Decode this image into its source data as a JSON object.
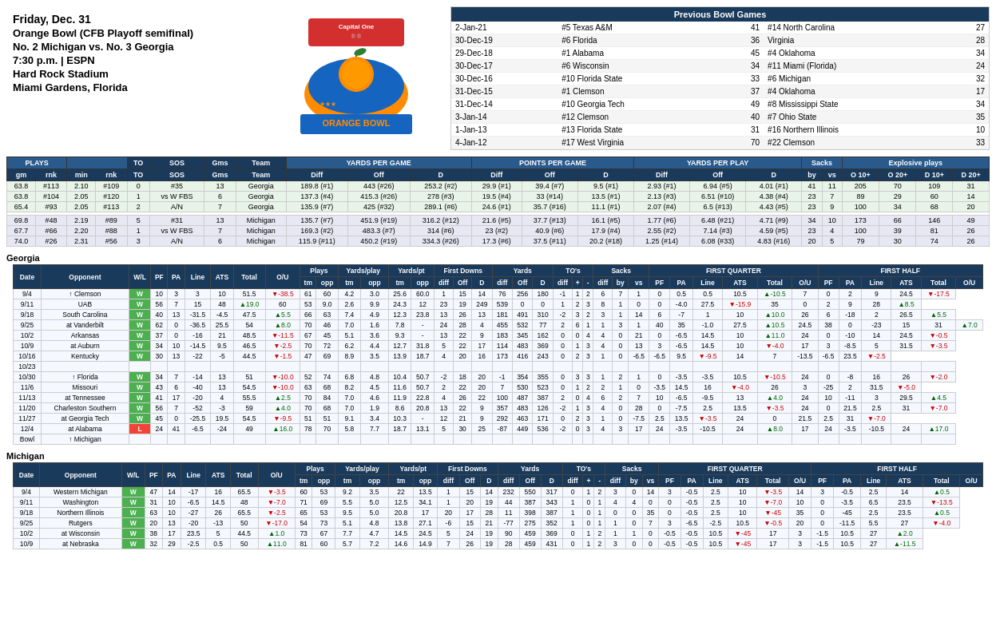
{
  "header": {
    "day": "Friday, Dec. 31",
    "bowl": "Orange Bowl (CFB Playoff semifinal)",
    "matchup": "No. 2 Michigan vs. No. 3 Georgia",
    "time": "7:30 p.m. | ESPN",
    "venue": "Hard Rock Stadium",
    "location": "Miami Gardens, Florida"
  },
  "previousBowlGames": {
    "title": "Previous Bowl Games",
    "columns": [
      "Date",
      "Team1",
      "Score1",
      "Team2",
      "Score2"
    ],
    "rows": [
      [
        "2-Jan-21",
        "#5 Texas A&M",
        "41",
        "#14 North Carolina",
        "27"
      ],
      [
        "30-Dec-19",
        "#6 Florida",
        "36",
        "Virginia",
        "28"
      ],
      [
        "29-Dec-18",
        "#1 Alabama",
        "45",
        "#4 Oklahoma",
        "34"
      ],
      [
        "30-Dec-17",
        "#6 Wisconsin",
        "34",
        "#11 Miami (Florida)",
        "24"
      ],
      [
        "30-Dec-16",
        "#10 Florida State",
        "33",
        "#6 Michigan",
        "32"
      ],
      [
        "31-Dec-15",
        "#1 Clemson",
        "37",
        "#4 Oklahoma",
        "17"
      ],
      [
        "31-Dec-14",
        "#10 Georgia Tech",
        "49",
        "#8 Mississippi State",
        "34"
      ],
      [
        "3-Jan-14",
        "#12 Clemson",
        "40",
        "#7 Ohio State",
        "35"
      ],
      [
        "1-Jan-13",
        "#13 Florida State",
        "31",
        "#16 Northern Illinois",
        "10"
      ],
      [
        "4-Jan-12",
        "#17 West Virginia",
        "70",
        "#22 Clemson",
        "33"
      ]
    ]
  },
  "statsSection": {
    "groupHeaders": {
      "plays": "PLAYS",
      "yardsPerGame": "YARDS PER GAME",
      "pointsPerGame": "POINTS PER GAME",
      "yardsPerPlay": "YARDS PER PLAY",
      "sacks": "Sacks",
      "explosivePlays": "Explosive plays"
    },
    "columnHeaders": [
      "gm",
      "rnk",
      "min",
      "rnk",
      "TO",
      "SOS",
      "Gms",
      "Team",
      "Diff",
      "Off",
      "D",
      "Diff",
      "Off",
      "D",
      "Diff",
      "Off",
      "D",
      "by",
      "vs",
      "O 10+",
      "O 20+",
      "D 10+",
      "D 20+"
    ],
    "georgiaRows": [
      [
        "63.8",
        "#113",
        "2.10",
        "#109",
        "0",
        "#35",
        "13",
        "Georgia",
        "189.8 (#1)",
        "443 (#26)",
        "253.2 (#2)",
        "29.9 (#1)",
        "39.4 (#7)",
        "9.5 (#1)",
        "2.93 (#1)",
        "6.94 (#5)",
        "4.01 (#1)",
        "41",
        "11",
        "205",
        "70",
        "109",
        "31"
      ],
      [
        "63.8",
        "#104",
        "2.05",
        "#120",
        "1",
        "vs W FBS",
        "6",
        "Georgia",
        "137.3 (#4)",
        "415.3 (#26)",
        "278 (#3)",
        "19.5 (#4)",
        "33 (#14)",
        "13.5 (#1)",
        "2.13 (#3)",
        "6.51 (#10)",
        "4.38 (#4)",
        "23",
        "7",
        "89",
        "29",
        "60",
        "14"
      ],
      [
        "65.4",
        "#93",
        "2.05",
        "#113",
        "2",
        "A/N",
        "7",
        "Georgia",
        "135.9 (#7)",
        "425 (#32)",
        "289.1 (#6)",
        "24.6 (#1)",
        "35.7 (#16)",
        "11.1 (#1)",
        "2.07 (#4)",
        "6.5 (#13)",
        "4.43 (#5)",
        "23",
        "9",
        "100",
        "34",
        "68",
        "20"
      ]
    ],
    "michiganRows": [
      [
        "69.8",
        "#48",
        "2.19",
        "#89",
        "5",
        "#31",
        "13",
        "Michigan",
        "135.7 (#7)",
        "451.9 (#19)",
        "316.2 (#12)",
        "21.6 (#5)",
        "37.7 (#13)",
        "16.1 (#5)",
        "1.77 (#6)",
        "6.48 (#21)",
        "4.71 (#9)",
        "34",
        "10",
        "173",
        "66",
        "146",
        "49"
      ],
      [
        "67.7",
        "#66",
        "2.20",
        "#88",
        "1",
        "vs W FBS",
        "7",
        "Michigan",
        "169.3 (#2)",
        "483.3 (#7)",
        "314 (#6)",
        "23 (#2)",
        "40.9 (#6)",
        "17.9 (#4)",
        "2.55 (#2)",
        "7.14 (#3)",
        "4.59 (#5)",
        "23",
        "4",
        "100",
        "39",
        "81",
        "26"
      ],
      [
        "74.0",
        "#26",
        "2.31",
        "#56",
        "3",
        "A/N",
        "6",
        "Michigan",
        "115.9 (#11)",
        "450.2 (#19)",
        "334.3 (#26)",
        "17.3 (#6)",
        "37.5 (#11)",
        "20.2 (#18)",
        "1.25 (#14)",
        "6.08 (#33)",
        "4.83 (#16)",
        "20",
        "5",
        "79",
        "30",
        "74",
        "26"
      ]
    ]
  },
  "georgiaGameLog": {
    "title": "Georgia",
    "columnGroups": [
      "Date",
      "Opponent",
      "W/L",
      "PF",
      "PA",
      "Line",
      "ATS",
      "Total",
      "O/U",
      "Plays",
      "Yards/play",
      "Yards/pt",
      "First Downs",
      "Yards",
      "TO's",
      "Sacks",
      "FIRST QUARTER",
      "FIRST HALF"
    ],
    "subHeaders": [
      "tm",
      "opp",
      "tm",
      "opp",
      "diff",
      "Off",
      "D",
      "diff",
      "Off",
      "D",
      "diff",
      "+",
      "-",
      "diff",
      "by",
      "vs",
      "PF",
      "PA",
      "Line",
      "ATS",
      "Total",
      "O/U",
      "PF",
      "PA",
      "Line",
      "ATS",
      "Total",
      "O/U"
    ],
    "rows": [
      [
        "9/4",
        "↑ Clemson",
        "W",
        "10",
        "3",
        "3",
        "10",
        "51.5",
        "▼-38.5",
        "61",
        "60",
        "4.2",
        "3.0",
        "25.6",
        "60.0",
        "1",
        "15",
        "14",
        "76",
        "256",
        "180",
        "-1",
        "1",
        "2",
        "6",
        "7",
        "1",
        "0",
        "0.5",
        "0.5",
        "10.5",
        "▲-10.5",
        "7",
        "0",
        "2",
        "9",
        "24.5",
        "▼-17.5"
      ],
      [
        "9/11",
        "UAB",
        "W",
        "56",
        "7",
        "15",
        "48",
        "▲19.0",
        "60",
        "53",
        "9.0",
        "2.6",
        "9.9",
        "24.3",
        "12",
        "23",
        "19",
        "249",
        "539",
        "0",
        "0",
        "1",
        "2",
        "3",
        "8",
        "1",
        "0",
        "0",
        "-4.0",
        "27.5",
        "▼-15.9",
        "35",
        "0",
        "2",
        "9",
        "28",
        "▲8.5"
      ],
      [
        "9/18",
        "South Carolina",
        "W",
        "40",
        "13",
        "-31.5",
        "-4.5",
        "47.5",
        "▲5.5",
        "66",
        "63",
        "7.4",
        "4.9",
        "12.3",
        "23.8",
        "13",
        "26",
        "13",
        "181",
        "491",
        "310",
        "-2",
        "3",
        "2",
        "3",
        "1",
        "14",
        "6",
        "-7",
        "1",
        "10",
        "▲10.0",
        "26",
        "6",
        "-18",
        "2",
        "26.5",
        "▲5.5"
      ],
      [
        "9/25",
        "at Vanderbilt",
        "W",
        "62",
        "0",
        "-36.5",
        "25.5",
        "54",
        "▲8.0",
        "70",
        "46",
        "7.0",
        "1.6",
        "7.8",
        "-",
        "24",
        "28",
        "4",
        "455",
        "532",
        "77",
        "2",
        "6",
        "1",
        "1",
        "3",
        "1",
        "40",
        "35",
        "-1.0",
        "27.5",
        "▲10.5",
        "24.5",
        "38",
        "0",
        "-23",
        "15",
        "31",
        "▲7.0"
      ],
      [
        "10/2",
        "Arkansas",
        "W",
        "37",
        "0",
        "-16",
        "21",
        "48.5",
        "▼-11.5",
        "67",
        "45",
        "5.1",
        "3.6",
        "9.3",
        "-",
        "13",
        "22",
        "9",
        "183",
        "345",
        "162",
        "0",
        "0",
        "4",
        "4",
        "0",
        "21",
        "0",
        "-6.5",
        "14.5",
        "10",
        "▲11.0",
        "24",
        "0",
        "-10",
        "14",
        "24.5",
        "▼-0.5"
      ],
      [
        "10/9",
        "at Auburn",
        "W",
        "34",
        "10",
        "-14.5",
        "9.5",
        "46.5",
        "▼-2.5",
        "70",
        "72",
        "6.2",
        "4.4",
        "12.7",
        "31.8",
        "5",
        "22",
        "17",
        "114",
        "483",
        "369",
        "0",
        "1",
        "3",
        "4",
        "0",
        "13",
        "3",
        "-6.5",
        "14.5",
        "10",
        "▼-4.0",
        "17",
        "3",
        "-8.5",
        "5",
        "31.5",
        "▼-3.5"
      ],
      [
        "10/16",
        "Kentucky",
        "W",
        "30",
        "13",
        "-22",
        "-5",
        "44.5",
        "▼-1.5",
        "47",
        "69",
        "8.9",
        "3.5",
        "13.9",
        "18.7",
        "4",
        "20",
        "16",
        "173",
        "416",
        "243",
        "0",
        "2",
        "3",
        "1",
        "0",
        "-6.5",
        "-6.5",
        "9.5",
        "▼-9.5",
        "14",
        "7",
        "-13.5",
        "-6.5",
        "23.5",
        "▼-2.5"
      ],
      [
        "10/23",
        "",
        "",
        "",
        "",
        "",
        "",
        "",
        "",
        "",
        "",
        "",
        "",
        "",
        "",
        "",
        "",
        "",
        "",
        "",
        "",
        "",
        "",
        "",
        "",
        "",
        "",
        "",
        "",
        "",
        "",
        "",
        "",
        "",
        "",
        "",
        "",
        ""
      ],
      [
        "10/30",
        "↑ Florida",
        "W",
        "34",
        "7",
        "-14",
        "13",
        "51",
        "▼-10.0",
        "52",
        "74",
        "6.8",
        "4.8",
        "10.4",
        "50.7",
        "-2",
        "18",
        "20",
        "-1",
        "354",
        "355",
        "0",
        "3",
        "3",
        "1",
        "2",
        "1",
        "0",
        "-3.5",
        "-3.5",
        "10.5",
        "▼-10.5",
        "24",
        "0",
        "-8",
        "16",
        "26",
        "▼-2.0"
      ],
      [
        "11/6",
        "Missouri",
        "W",
        "43",
        "6",
        "-40",
        "13",
        "54.5",
        "▼-10.0",
        "63",
        "68",
        "8.2",
        "4.5",
        "11.6",
        "50.7",
        "2",
        "22",
        "20",
        "7",
        "530",
        "523",
        "0",
        "1",
        "2",
        "2",
        "1",
        "0",
        "-3.5",
        "14.5",
        "16",
        "▼-4.0",
        "26",
        "3",
        "-25",
        "2",
        "31.5",
        "▼-5.0"
      ],
      [
        "11/13",
        "at Tennessee",
        "W",
        "41",
        "17",
        "-20",
        "4",
        "55.5",
        "▲2.5",
        "70",
        "84",
        "7.0",
        "4.6",
        "11.9",
        "22.8",
        "4",
        "26",
        "22",
        "100",
        "487",
        "387",
        "2",
        "0",
        "4",
        "6",
        "2",
        "7",
        "10",
        "-6.5",
        "-9.5",
        "13",
        "▲4.0",
        "24",
        "10",
        "-11",
        "3",
        "29.5",
        "▲4.5"
      ],
      [
        "11/20",
        "Charleston Southern",
        "W",
        "56",
        "7",
        "-52",
        "-3",
        "59",
        "▲4.0",
        "70",
        "68",
        "7.0",
        "1.9",
        "8.6",
        "20.8",
        "13",
        "22",
        "9",
        "357",
        "483",
        "126",
        "-2",
        "1",
        "3",
        "4",
        "0",
        "28",
        "0",
        "-7.5",
        "2.5",
        "13.5",
        "▼-3.5",
        "24",
        "0",
        "21.5",
        "2.5",
        "31",
        "▼-7.0"
      ],
      [
        "11/27",
        "at Georgia Tech",
        "W",
        "45",
        "0",
        "-25.5",
        "19.5",
        "54.5",
        "▼-9.5",
        "51",
        "51",
        "9.1",
        "3.4",
        "10.3",
        "-",
        "12",
        "21",
        "9",
        "292",
        "463",
        "171",
        "0",
        "2",
        "3",
        "1",
        "0",
        "-7.5",
        "2.5",
        "13.5",
        "▼-3.5",
        "24",
        "0",
        "21.5",
        "2.5",
        "31",
        "▼-7.0"
      ],
      [
        "12/4",
        "at Alabama",
        "L",
        "24",
        "41",
        "-6.5",
        "-24",
        "49",
        "▲16.0",
        "78",
        "70",
        "5.8",
        "7.7",
        "18.7",
        "13.1",
        "5",
        "30",
        "25",
        "-87",
        "449",
        "536",
        "-2",
        "0",
        "3",
        "4",
        "3",
        "17",
        "24",
        "-3.5",
        "-10.5",
        "24",
        "▲8.0",
        "17",
        "24",
        "-3.5",
        "-10.5",
        "24",
        "▲17.0"
      ],
      [
        "Bowl",
        "↑ Michigan",
        "",
        "",
        "",
        "",
        "",
        "",
        "",
        "",
        "",
        "",
        "",
        "",
        "",
        "",
        "",
        "",
        "",
        "",
        "",
        "",
        "",
        "",
        "",
        "",
        "",
        "",
        "",
        "",
        "",
        "",
        "",
        "",
        "",
        "",
        "",
        ""
      ]
    ]
  },
  "michiganGameLog": {
    "title": "Michigan",
    "rows": [
      [
        "9/4",
        "Western Michigan",
        "W",
        "47",
        "14",
        "-17",
        "16",
        "65.5",
        "▼-3.5",
        "60",
        "53",
        "9.2",
        "3.5",
        "22",
        "13.5",
        "1",
        "15",
        "14",
        "232",
        "550",
        "317",
        "0",
        "1",
        "2",
        "3",
        "0",
        "14",
        "3",
        "-0.5",
        "2.5",
        "10",
        "▼-3.5",
        "14",
        "3",
        "-0.5",
        "2.5",
        "14",
        "▲0.5"
      ],
      [
        "9/11",
        "Washington",
        "W",
        "31",
        "10",
        "-6.5",
        "14.5",
        "48",
        "▼-7.0",
        "71",
        "69",
        "5.5",
        "5.0",
        "12.5",
        "34.1",
        "1",
        "20",
        "19",
        "44",
        "387",
        "343",
        "1",
        "0",
        "1",
        "4",
        "4",
        "0",
        "0",
        "-0.5",
        "2.5",
        "10",
        "▼-7.0",
        "10",
        "0",
        "-3.5",
        "6.5",
        "23.5",
        "▼-13.5"
      ],
      [
        "9/18",
        "Northern Illinois",
        "W",
        "63",
        "10",
        "-27",
        "26",
        "65.5",
        "▼-2.5",
        "65",
        "53",
        "9.5",
        "5.0",
        "20.8",
        "17",
        "20",
        "17",
        "28",
        "11",
        "398",
        "387",
        "1",
        "0",
        "1",
        "0",
        "0",
        "35",
        "0",
        "-0.5",
        "2.5",
        "10",
        "▼-45",
        "35",
        "0",
        "-45",
        "2.5",
        "23.5",
        "▲0.5"
      ],
      [
        "9/25",
        "Rutgers",
        "W",
        "20",
        "13",
        "-20",
        "-13",
        "50",
        "▼-17.0",
        "54",
        "73",
        "5.1",
        "4.8",
        "13.8",
        "27.1",
        "-6",
        "15",
        "21",
        "-77",
        "275",
        "352",
        "1",
        "0",
        "1",
        "1",
        "0",
        "7",
        "3",
        "-6.5",
        "-2.5",
        "10.5",
        "▼-0.5",
        "20",
        "0",
        "-11.5",
        "5.5",
        "27",
        "▼-4.0"
      ],
      [
        "10/2",
        "at Wisconsin",
        "W",
        "38",
        "17",
        "23.5",
        "5",
        "44.5",
        "▲1.0",
        "73",
        "67",
        "7.7",
        "4.7",
        "14.5",
        "24.5",
        "5",
        "24",
        "19",
        "90",
        "459",
        "369",
        "0",
        "1",
        "2",
        "1",
        "1",
        "0",
        "-0.5",
        "-0.5",
        "10.5",
        "▼-45",
        "17",
        "3",
        "-1.5",
        "10.5",
        "27",
        "▲2.0"
      ],
      [
        "10/9",
        "at Nebraska",
        "W",
        "32",
        "29",
        "-2.5",
        "0.5",
        "50",
        "▲11.0",
        "81",
        "60",
        "5.7",
        "7.2",
        "14.6",
        "14.9",
        "7",
        "26",
        "19",
        "28",
        "459",
        "431",
        "0",
        "1",
        "2",
        "3",
        "0",
        "0",
        "-0.5",
        "-0.5",
        "10.5",
        "▼-45",
        "17",
        "3",
        "-1.5",
        "10.5",
        "27",
        "▲-11.5"
      ]
    ]
  },
  "colors": {
    "headerBg": "#1a3a5c",
    "altHeaderBg": "#2a5a8c",
    "winGreen": "#4caf50",
    "lossRed": "#f44336",
    "georgiaRowBg": "#e8f4e8",
    "michiganRowBg": "#e8e8f4",
    "upArrowColor": "#006600",
    "downArrowColor": "#cc0000"
  }
}
